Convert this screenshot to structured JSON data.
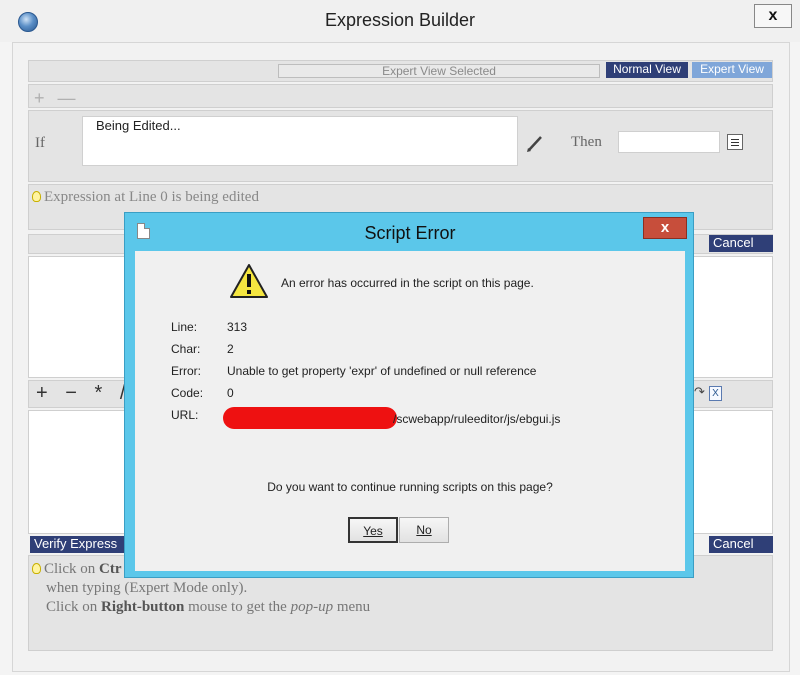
{
  "window": {
    "title": "Expression Builder",
    "close_label": "x"
  },
  "toolbar": {
    "expert_selected": "Expert View Selected",
    "normal_view": "Normal View",
    "expert_view": "Expert View",
    "add_remove": "+ —"
  },
  "condition": {
    "if_label": "If",
    "if_value": "Being Edited...",
    "then_label": "Then",
    "then_value": ""
  },
  "hint_line": "Expression at Line 0 is being edited",
  "buttons": {
    "cancel": "Cancel",
    "verify": "Verify Express"
  },
  "operators": "+ − * /",
  "help": {
    "line1_prefix": "Click on ",
    "line1_bold": "Ctr",
    "line2": "when typing (Expert Mode only).",
    "line3_prefix": "Click on ",
    "line3_bold": "Right-button",
    "line3_mid": " mouse to get the ",
    "line3_em": "pop-up",
    "line3_suffix": " menu"
  },
  "dialog": {
    "title": "Script Error",
    "close_label": "x",
    "message": "An error has occurred in the script on this page.",
    "fields": [
      {
        "label": "Line:",
        "value": "313"
      },
      {
        "label": "Char:",
        "value": "2"
      },
      {
        "label": "Error:",
        "value": "Unable to get property 'expr' of undefined or null reference"
      },
      {
        "label": "Code:",
        "value": "0"
      },
      {
        "label": "URL:",
        "value": "/scwebapp/ruleeditor/js/ebgui.js"
      }
    ],
    "question": "Do you want to continue running scripts on this page?",
    "yes_label": "Yes",
    "no_label": "No"
  },
  "colors": {
    "dark_blue": "#2f3f77",
    "dialog_frame": "#5bc7ea",
    "close_red": "#c74e3b",
    "redaction": "#ee1111"
  }
}
